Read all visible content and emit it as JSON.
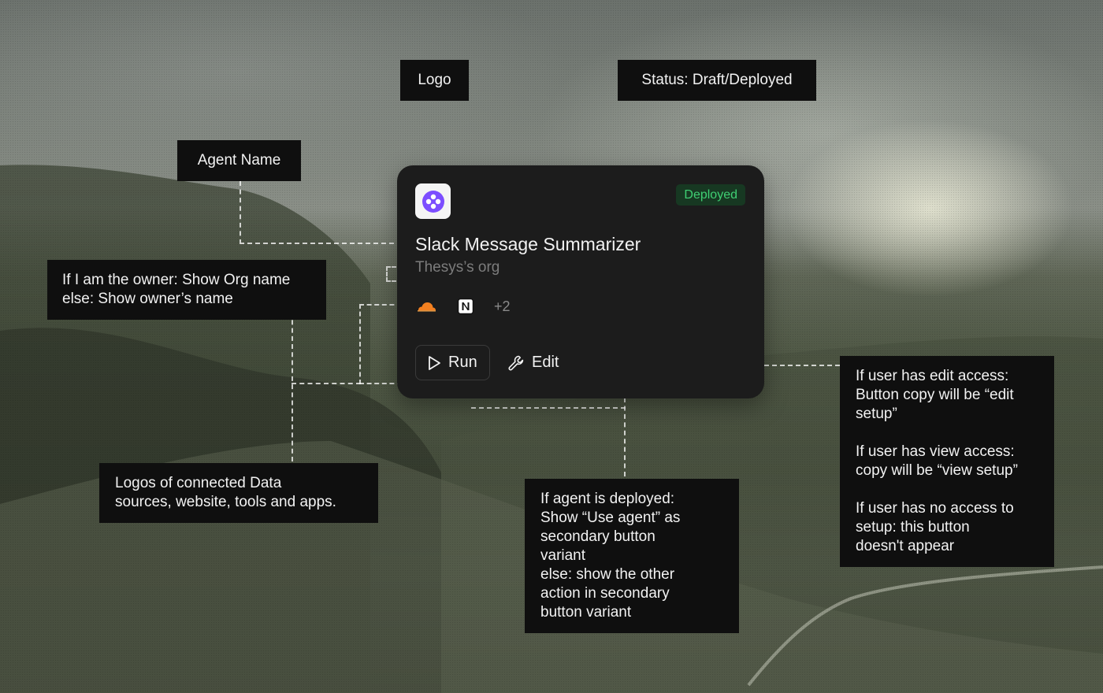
{
  "card": {
    "agent_name": "Slack Message Summarizer",
    "org_name": "Thesys’s org",
    "status": "Deployed",
    "status_color": "#3fcf73",
    "logo_color": "#7c4dff",
    "sources": [
      "cloudflare-icon",
      "notion-icon"
    ],
    "more_sources": "+2",
    "run_label": "Run",
    "edit_label": "Edit"
  },
  "annotations": {
    "logo": "Logo",
    "status": "Status: Draft/Deployed",
    "agent_name": "Agent Name",
    "org": "If I am the owner: Show Org name\nelse: Show owner’s name",
    "logos": "Logos of connected Data\nsources, website, tools and apps.",
    "run": "If agent is deployed:\nShow “Use agent” as\nsecondary button\nvariant\nelse: show the other\naction in secondary\nbutton variant",
    "edit": "If user has edit access:\nButton copy will be “edit\nsetup”\n\nIf user has view access:\ncopy will be “view setup”\n\nIf user has no access to\nsetup: this button\ndoesn't appear"
  }
}
